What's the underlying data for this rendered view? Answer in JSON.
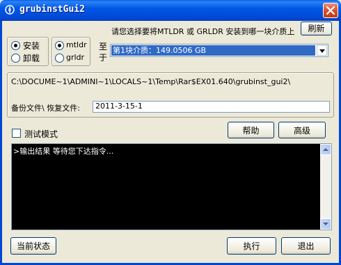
{
  "window": {
    "title": "grubinstGui2",
    "title_bar_color": "#0047d4",
    "close_icon": "close-icon"
  },
  "action_group": {
    "install_label": "安装",
    "uninstall_label": "卸载",
    "selected": "安装"
  },
  "loader_group": {
    "mtldr_label": "mtldr",
    "grldr_label": "grldr",
    "selected": "mtldr"
  },
  "target": {
    "instruction": "请您选择要将MTLDR 或 GRLDR 安装到哪一块介质上",
    "refresh_label": "刷新",
    "to_label_1": "至",
    "to_label_2": "于",
    "selected_media": "第1块介质：149.0506 GB",
    "selected_color": "#316ac5"
  },
  "paths": {
    "temp_path": "C:\\DOCUME~1\\ADMINI~1\\LOCALS~1\\Temp\\Rar$EX01.640\\grubinst_gui2\\",
    "backup_label": "备份文件\\ 恢复文件:",
    "backup_value": "2011-3-15-1"
  },
  "options": {
    "test_mode_label": "测试模式",
    "test_mode_checked": false,
    "help_label": "帮助",
    "advanced_label": "高级"
  },
  "output": {
    "text": ">输出结果 等待您下达指令...",
    "background": "#000000"
  },
  "footer": {
    "status_label": "当前状态",
    "execute_label": "执行",
    "exit_label": "退出"
  }
}
